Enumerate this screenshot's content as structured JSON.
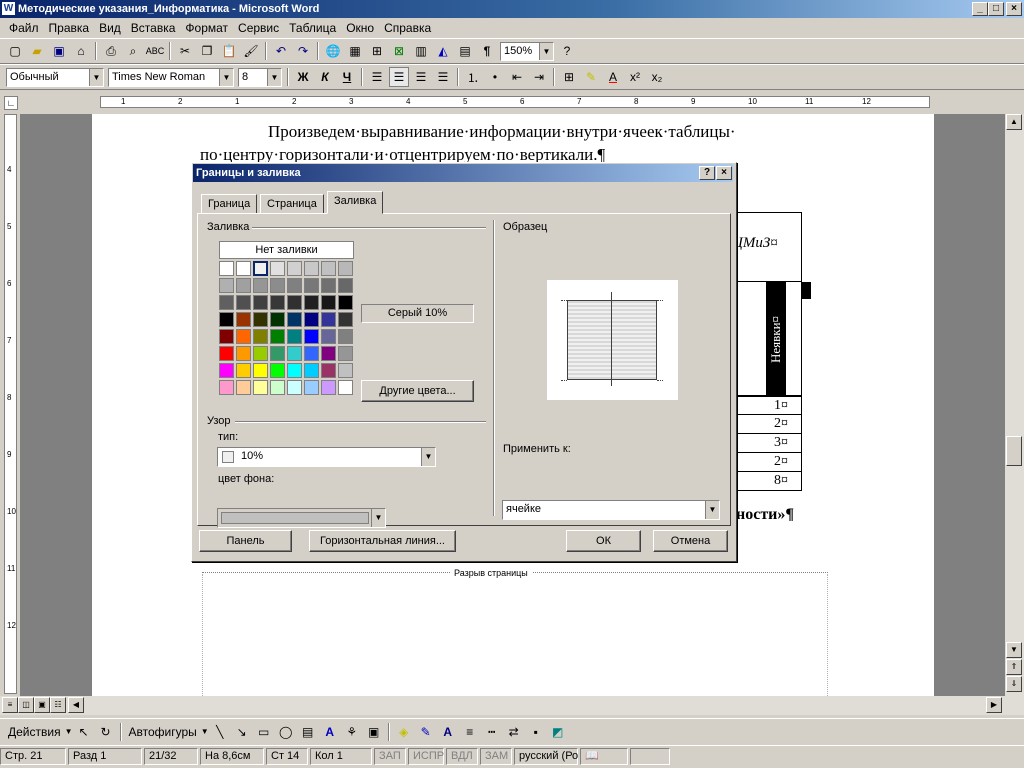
{
  "window": {
    "title": "Методические указания_Информатика - Microsoft Word"
  },
  "menu": [
    "Файл",
    "Правка",
    "Вид",
    "Вставка",
    "Формат",
    "Сервис",
    "Таблица",
    "Окно",
    "Справка"
  ],
  "toolbar": {
    "zoom": "150%"
  },
  "format": {
    "style": "Обычный",
    "font": "Times New Roman",
    "size": "8",
    "bold": "Ж",
    "italic": "К",
    "underline": "Ч"
  },
  "ruler": {
    "ticks": [
      "1",
      "2",
      "1",
      "2",
      "3",
      "4",
      "5",
      "6",
      "7",
      "8",
      "9",
      "10",
      "11",
      "12"
    ]
  },
  "vruler": {
    "ticks": [
      "4",
      "5",
      "6",
      "7",
      "8",
      "9",
      "10",
      "11",
      "12"
    ]
  },
  "doc": {
    "line1": "Произведем·выравнивание·информации·внутри·ячеек·таблицы·",
    "line2": "по·центру·горизонтали·и·отцентрируем·по·вертикали.¶",
    "cell_header": "ЦМиЗ¤",
    "col_vertical": "Неявки¤",
    "values": [
      "1¤",
      "2¤",
      "3¤",
      "2¤",
      "8¤"
    ],
    "bottom_text": "ности»¶",
    "page_break": "Разрыв страницы"
  },
  "dialog": {
    "title": "Границы и заливка",
    "tabs": [
      "Граница",
      "Страница",
      "Заливка"
    ],
    "fill_group": "Заливка",
    "no_fill": "Нет заливки",
    "selected_color": "Серый 10%",
    "more_colors": "Другие цвета...",
    "pattern_group": "Узор",
    "type_label": "тип:",
    "type_value": "10%",
    "bg_color_label": "цвет фона:",
    "preview_group": "Образец",
    "apply_label": "Применить к:",
    "apply_value": "ячейке",
    "btn_panel": "Панель",
    "btn_hline": "Горизонтальная линия...",
    "btn_ok": "ОК",
    "btn_cancel": "Отмена",
    "palette": [
      [
        "#ffffff",
        "#ffffff",
        "#f0f0f0",
        "#e0e0e0",
        "#d0d0d0",
        "#c8c8c8",
        "#c0c0c0",
        "#b8b8b8"
      ],
      [
        "#b0b0b0",
        "#a0a0a0",
        "#969696",
        "#8c8c8c",
        "#808080",
        "#787878",
        "#707070",
        "#686868"
      ],
      [
        "#606060",
        "#505050",
        "#404040",
        "#383838",
        "#303030",
        "#202020",
        "#181818",
        "#000000"
      ],
      [
        "#000000",
        "#993300",
        "#333300",
        "#003300",
        "#003366",
        "#000080",
        "#333399",
        "#333333"
      ],
      [
        "#800000",
        "#ff6600",
        "#808000",
        "#008000",
        "#008080",
        "#0000ff",
        "#666699",
        "#808080"
      ],
      [
        "#ff0000",
        "#ff9900",
        "#99cc00",
        "#339966",
        "#33cccc",
        "#3366ff",
        "#800080",
        "#969696"
      ],
      [
        "#ff00ff",
        "#ffcc00",
        "#ffff00",
        "#00ff00",
        "#00ffff",
        "#00ccff",
        "#993366",
        "#c0c0c0"
      ],
      [
        "#ff99cc",
        "#ffcc99",
        "#ffff99",
        "#ccffcc",
        "#ccffff",
        "#99ccff",
        "#cc99ff",
        "#ffffff"
      ]
    ]
  },
  "drawing": {
    "actions": "Действия",
    "autoshapes": "Автофигуры"
  },
  "status": {
    "page": "Стр. 21",
    "section": "Разд 1",
    "pages": "21/32",
    "at": "На 8,6см",
    "line": "Ст 14",
    "col": "Кол 1",
    "rec": "ЗАП",
    "trk": "ИСПР",
    "ext": "ВДЛ",
    "ovr": "ЗАМ",
    "lang": "русский (Ро"
  }
}
